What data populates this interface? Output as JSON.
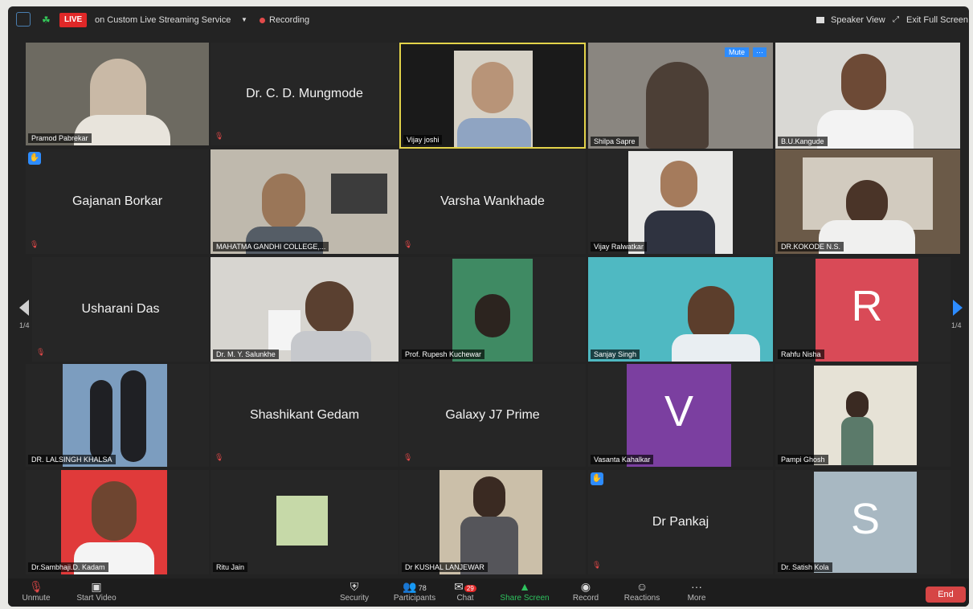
{
  "topbar": {
    "live_badge": "LIVE",
    "stream_title": "on Custom Live Streaming Service",
    "recording": "Recording",
    "speaker_view": "Speaker View",
    "exit_full_screen": "Exit Full Screen"
  },
  "pagination": {
    "left": "1/4",
    "right": "1/4"
  },
  "tiles": {
    "pramod": "Pramod Pabrekar",
    "mungmode": "Dr. C. D. Mungmode",
    "vijay_joshi": "Vijay joshi",
    "shilpa": "Shilpa Sapre",
    "shilpa_mute": "Mute",
    "kangude": "B.U.Kangude",
    "gajanan": "Gajanan Borkar",
    "mgc": "MAHATMA GANDHI COLLEGE,...",
    "varsha": "Varsha Wankhade",
    "ralwatkar": "Vijay Ralwatkar",
    "kokode": "DR.KOKODE N.S.",
    "usharani": "Usharani Das",
    "salunkhe": "Dr. M. Y. Salunkhe",
    "kuchewar": "Prof. Rupesh Kuchewar",
    "sanjay": "Sanjay Singh",
    "rahfu": "Rahfu Nisha",
    "rahfu_letter": "R",
    "khalsa": "DR. LALSINGH KHALSA",
    "shashikant": "Shashikant Gedam",
    "galaxy": "Galaxy J7 Prime",
    "vasanta": "Vasanta Kahalkar",
    "vasanta_letter": "V",
    "pampi": "Pampi Ghosh",
    "kadam": "Dr.Sambhaji.D. Kadam",
    "ritu": "Ritu Jain",
    "lanjewar": "Dr KUSHAL LANJEWAR",
    "pankaj": "Dr Pankaj",
    "kola": "Dr.  Satish Kola",
    "kola_letter": "S"
  },
  "bottombar": {
    "unmute": "Unmute",
    "start_video": "Start Video",
    "security": "Security",
    "participants": "Participants",
    "participants_count": "78",
    "chat": "Chat",
    "chat_badge": "29",
    "share_screen": "Share Screen",
    "record": "Record",
    "reactions": "Reactions",
    "more": "More",
    "end": "End"
  },
  "colors": {
    "live": "#e02828",
    "share": "#2ec25e",
    "end": "#d64545",
    "tile_rahfu": "#d94a57",
    "tile_vasanta": "#7b3fa0",
    "tile_kola": "#a8b8c2",
    "raise_hand": "#2d8cff"
  }
}
